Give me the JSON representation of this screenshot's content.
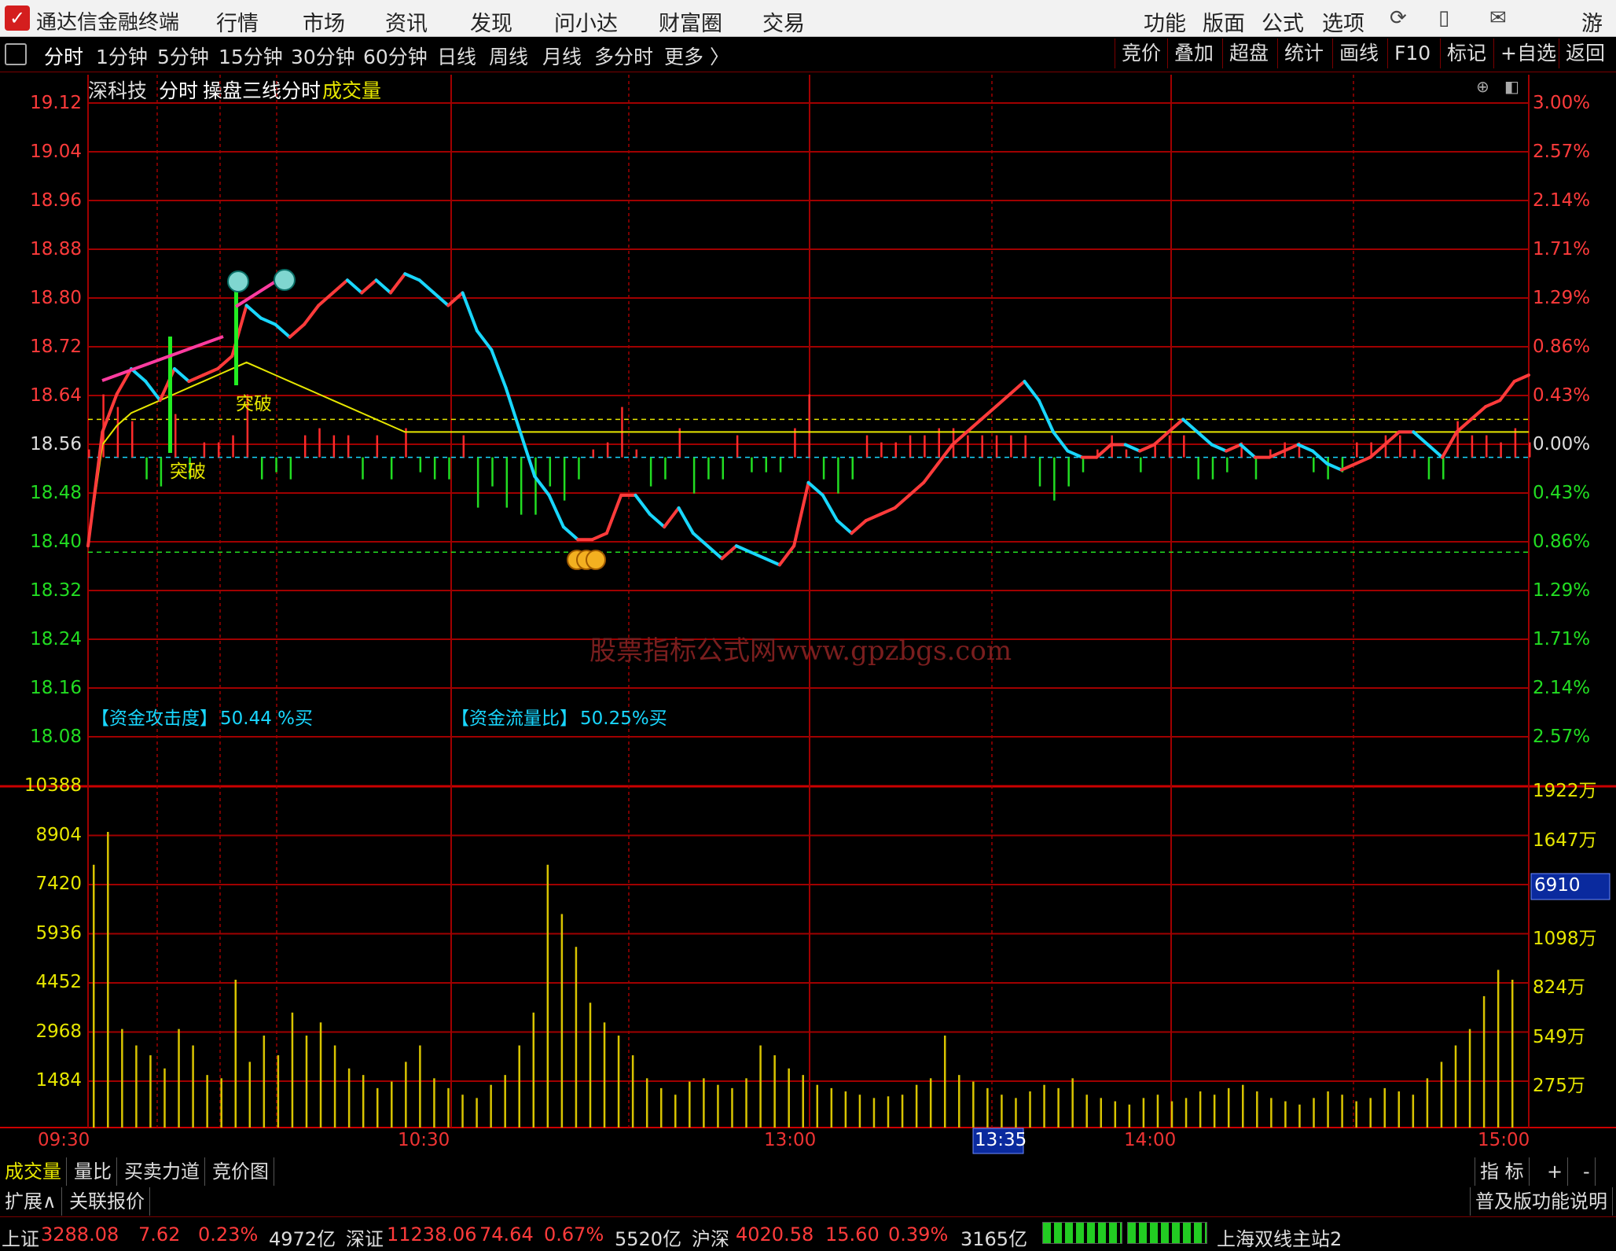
{
  "app": {
    "title": "通达信金融终端"
  },
  "menu": {
    "items": [
      "行情",
      "市场",
      "资讯",
      "发现",
      "问小达",
      "财富圈",
      "交易"
    ],
    "right_items": [
      "功能",
      "版面",
      "公式",
      "选项"
    ],
    "user": "游客"
  },
  "periods": {
    "items": [
      "分时",
      "1分钟",
      "5分钟",
      "15分钟",
      "30分钟",
      "60分钟",
      "日线",
      "周线",
      "月线",
      "多分时",
      "更多 〉"
    ],
    "active": "分时"
  },
  "right_buttons": [
    "竞价",
    "叠加",
    "超盘",
    "统计",
    "画线",
    "F10",
    "标记",
    "+自选",
    "返回"
  ],
  "chart_header": {
    "stock": "深科技",
    "mode": "分时",
    "formula": "操盘三线分时",
    "sub": "成交量"
  },
  "price_axis": [
    "19.12",
    "19.04",
    "18.96",
    "18.88",
    "18.80",
    "18.72",
    "18.64",
    "18.56",
    "18.48",
    "18.40",
    "18.32",
    "18.24",
    "18.16",
    "18.08"
  ],
  "pct_axis": [
    "3.00%",
    "2.57%",
    "2.14%",
    "1.71%",
    "1.29%",
    "0.86%",
    "0.43%",
    "0.00%",
    "0.43%",
    "0.86%",
    "1.29%",
    "1.71%",
    "2.14%",
    "2.57%"
  ],
  "vol_axis_left": [
    "10388",
    "8904",
    "7420",
    "5936",
    "4452",
    "2968",
    "1484"
  ],
  "vol_axis_right": [
    "1922万",
    "1647万",
    "",
    "1098万",
    "824万",
    "549万",
    "275万"
  ],
  "vol_cursor": "6910",
  "time_axis": [
    "09:30",
    "10:30",
    "13:00",
    "13:35",
    "14:00",
    "15:00"
  ],
  "signals": [
    "突破",
    "突破"
  ],
  "indicators": {
    "attack_label": "【资金攻击度】",
    "attack_value": "50.44 %买",
    "flow_label": "【资金流量比】",
    "flow_value": "50.25%买"
  },
  "watermark": "股票指标公式网www.gpzbgs.com",
  "bottom_tabs": [
    "成交量",
    "量比",
    "买卖力道",
    "竞价图"
  ],
  "bottom_tabs_right": [
    "指 标",
    "+",
    "-"
  ],
  "bottom_tabs2": [
    "扩展∧",
    "关联报价"
  ],
  "help_link": "普及版功能说明",
  "status": {
    "sh_label": "上证",
    "sh_val": "3288.08",
    "sh_chg": "7.62",
    "sh_pct": "0.23%",
    "sh_amt": "4972亿",
    "sz_label": "深证",
    "sz_val": "11238.06",
    "sz_chg": "74.64",
    "sz_pct": "0.67%",
    "sz_amt": "5520亿",
    "hs_label": "沪深",
    "hs_val": "4020.58",
    "hs_chg": "15.60",
    "hs_pct": "0.39%",
    "hs_amt": "3165亿",
    "server": "上海双线主站2"
  },
  "colors": {
    "up": "#ff3b3b",
    "down": "#19d7ff",
    "avg": "#e6e600",
    "vol": "#d9c400",
    "grid": "#a00000"
  },
  "chart_data": {
    "type": "line",
    "prev_close": 18.56,
    "price_range": [
      18.04,
      19.12
    ],
    "price": [
      18.42,
      18.6,
      18.66,
      18.7,
      18.68,
      18.65,
      18.7,
      18.68,
      18.69,
      18.7,
      18.72,
      18.8,
      18.78,
      18.77,
      18.75,
      18.77,
      18.8,
      18.82,
      18.84,
      18.82,
      18.84,
      18.82,
      18.85,
      18.84,
      18.82,
      18.8,
      18.82,
      18.76,
      18.73,
      18.67,
      18.6,
      18.53,
      18.5,
      18.45,
      18.43,
      18.43,
      18.44,
      18.5,
      18.5,
      18.47,
      18.45,
      18.48,
      18.44,
      18.42,
      18.4,
      18.42,
      18.41,
      18.4,
      18.39,
      18.42,
      18.52,
      18.5,
      18.46,
      18.44,
      18.46,
      18.47,
      18.48,
      18.5,
      18.52,
      18.55,
      18.58,
      18.6,
      18.62,
      18.64,
      18.66,
      18.68,
      18.65,
      18.6,
      18.57,
      18.56,
      18.56,
      18.58,
      18.58,
      18.57,
      18.58,
      18.6,
      18.62,
      18.6,
      18.58,
      18.57,
      18.58,
      18.56,
      18.56,
      18.57,
      18.58,
      18.57,
      18.55,
      18.54,
      18.55,
      18.56,
      18.58,
      18.6,
      18.6,
      18.58,
      18.56,
      18.6,
      18.62,
      18.64,
      18.65,
      18.68,
      18.69
    ],
    "avg": [
      18.42,
      18.58,
      18.61,
      18.63,
      18.64,
      18.65,
      18.66,
      18.67,
      18.68,
      18.69,
      18.7,
      18.71,
      18.7,
      18.69,
      18.68,
      18.67,
      18.66,
      18.65,
      18.64,
      18.63,
      18.62,
      18.61,
      18.6,
      18.6,
      18.6,
      18.6,
      18.6,
      18.6,
      18.6,
      18.6,
      18.6,
      18.6,
      18.6,
      18.6,
      18.6,
      18.6,
      18.6,
      18.6,
      18.6,
      18.6,
      18.6,
      18.6,
      18.6,
      18.6,
      18.6,
      18.6,
      18.6,
      18.6,
      18.6,
      18.6,
      18.6,
      18.6,
      18.6,
      18.6,
      18.6,
      18.6,
      18.6,
      18.6,
      18.6,
      18.6,
      18.6,
      18.6,
      18.6,
      18.6,
      18.6,
      18.6,
      18.6,
      18.6,
      18.6,
      18.6,
      18.6,
      18.6,
      18.6,
      18.6,
      18.6,
      18.6,
      18.6,
      18.6,
      18.6,
      18.6,
      18.6,
      18.6,
      18.6,
      18.6,
      18.6,
      18.6,
      18.6,
      18.6,
      18.6,
      18.6,
      18.6,
      18.6,
      18.6,
      18.6,
      18.6,
      18.6,
      18.6,
      18.6,
      18.6,
      18.6,
      18.6
    ],
    "volume": [
      8000,
      9000,
      3000,
      2500,
      2200,
      1800,
      3000,
      2500,
      1600,
      1500,
      4500,
      2000,
      2800,
      2200,
      3500,
      2800,
      3200,
      2500,
      1800,
      1600,
      1200,
      1400,
      2000,
      2500,
      1500,
      1200,
      1000,
      900,
      1300,
      1600,
      2500,
      3500,
      8000,
      6500,
      5500,
      3800,
      3200,
      2800,
      2200,
      1500,
      1200,
      1000,
      1400,
      1500,
      1300,
      1200,
      1500,
      2500,
      2200,
      1800,
      1600,
      1300,
      1200,
      1100,
      1000,
      900,
      950,
      1000,
      1300,
      1500,
      2800,
      1600,
      1400,
      1200,
      1000,
      900,
      1100,
      1300,
      1200,
      1500,
      1000,
      900,
      800,
      700,
      900,
      1000,
      800,
      900,
      1100,
      1000,
      1200,
      1300,
      1100,
      900,
      800,
      700,
      900,
      1100,
      1000,
      800,
      900,
      1200,
      1100,
      1000,
      1500,
      2000,
      2500,
      3000,
      4000,
      4800,
      4500
    ]
  }
}
